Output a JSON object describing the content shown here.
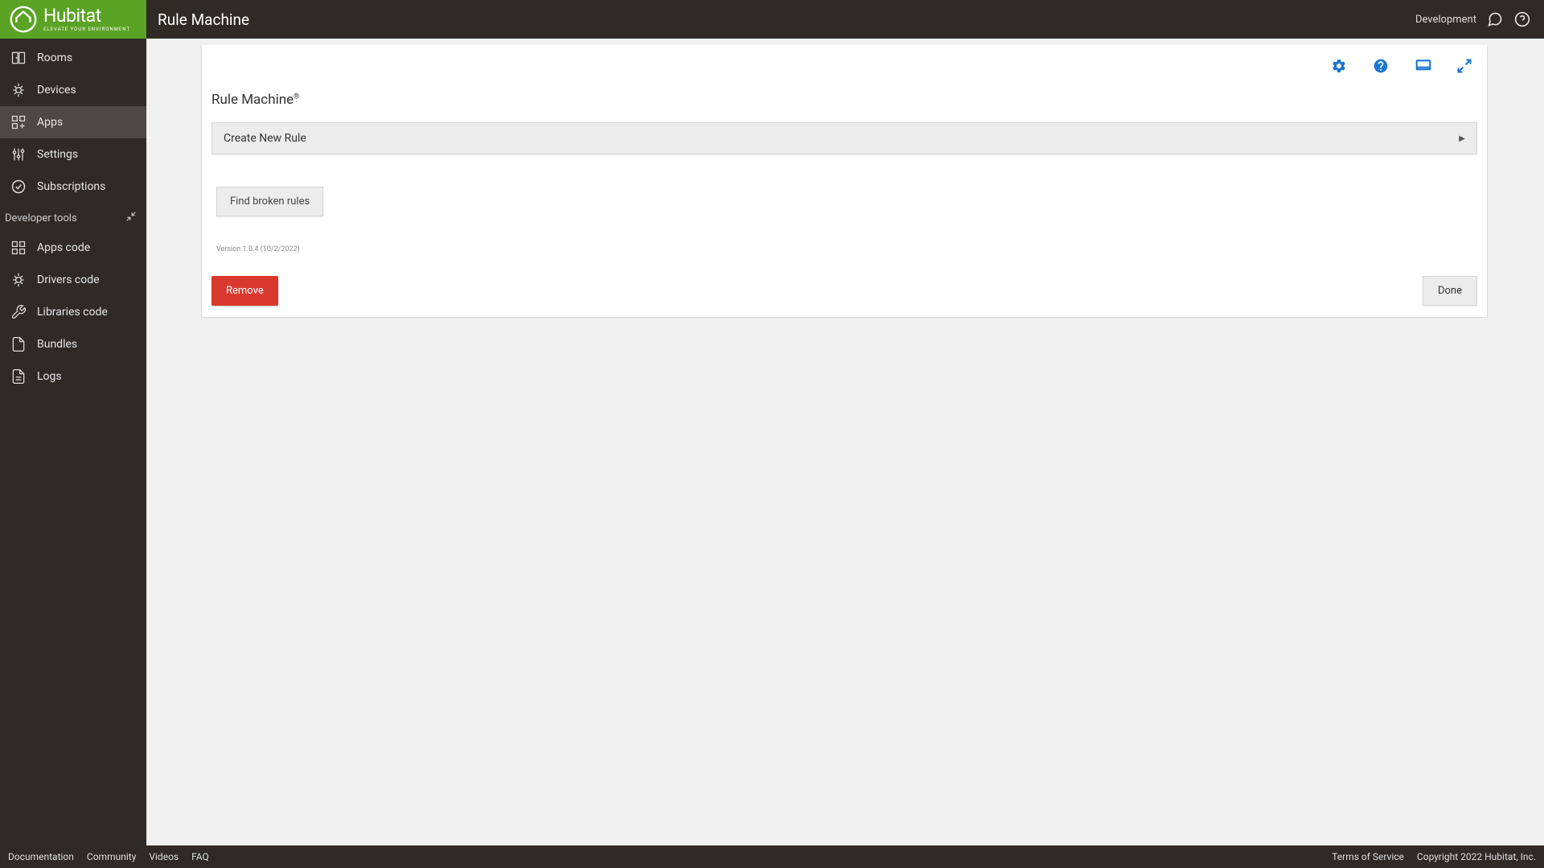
{
  "header": {
    "logo_name": "Hubitat",
    "logo_tagline": "ELEVATE YOUR ENVIRONMENT",
    "page_title": "Rule Machine",
    "development_label": "Development"
  },
  "sidebar": {
    "items": [
      {
        "label": "Rooms"
      },
      {
        "label": "Devices"
      },
      {
        "label": "Apps"
      },
      {
        "label": "Settings"
      },
      {
        "label": "Subscriptions"
      }
    ],
    "dev_section_label": "Developer tools",
    "dev_items": [
      {
        "label": "Apps code"
      },
      {
        "label": "Drivers code"
      },
      {
        "label": "Libraries code"
      },
      {
        "label": "Bundles"
      },
      {
        "label": "Logs"
      }
    ]
  },
  "panel": {
    "title": "Rule Machine",
    "title_superscript": "®",
    "create_rule_label": "Create New Rule",
    "find_broken_label": "Find broken rules",
    "version_text": "Version 1.0.4 (10/2/2022)",
    "remove_label": "Remove",
    "done_label": "Done"
  },
  "footer": {
    "links_left": [
      "Documentation",
      "Community",
      "Videos",
      "FAQ"
    ],
    "terms_label": "Terms of Service",
    "copyright": "Copyright 2022 Hubitat, Inc."
  }
}
